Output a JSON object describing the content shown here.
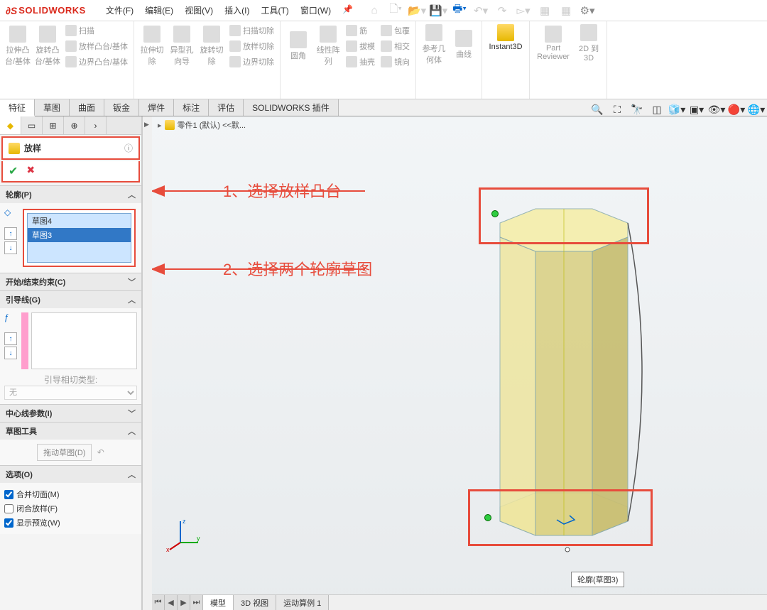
{
  "app": {
    "name": "SOLIDWORKS",
    "logo_prefix": "S"
  },
  "menu": {
    "file": "文件(F)",
    "edit": "编辑(E)",
    "view": "视图(V)",
    "insert": "插入(I)",
    "tools": "工具(T)",
    "window": "窗口(W)"
  },
  "ribbon": {
    "extrude": "拉伸凸台/基体",
    "revolve": "旋转凸台/基体",
    "sweep": "扫描",
    "loft": "放样凸台/基体",
    "boundary": "边界凸台/基体",
    "cut_extrude": "拉伸切除",
    "hole": "异型孔向导",
    "cut_revolve": "旋转切除",
    "cut_sweep": "扫描切除",
    "cut_loft": "放样切除",
    "cut_boundary": "边界切除",
    "fillet": "圆角",
    "pattern": "线性阵列",
    "rib": "筋",
    "draft": "拔模",
    "shell": "抽壳",
    "wrap": "包覆",
    "intersect": "相交",
    "mirror": "镜向",
    "refgeom": "参考几何体",
    "curves": "曲线",
    "instant3d": "Instant3D",
    "part_reviewer": "Part Reviewer",
    "to3d": "2D 到 3D"
  },
  "tabs": {
    "feature": "特征",
    "sketch": "草图",
    "surface": "曲面",
    "sheetmetal": "钣金",
    "weldment": "焊件",
    "annotate": "标注",
    "evaluate": "评估",
    "swplugin": "SOLIDWORKS 插件"
  },
  "breadcrumb": {
    "part": "零件1 (默认) <<默..."
  },
  "feature": {
    "title": "放样",
    "profiles_hdr": "轮廓(P)",
    "profile_items": [
      "草图4",
      "草图3"
    ],
    "constraints_hdr": "开始/结束约束(C)",
    "guides_hdr": "引导线(G)",
    "guide_tangent_label": "引导相切类型:",
    "guide_tangent_value": "无",
    "centerline_hdr": "中心线参数(I)",
    "sketchtools_hdr": "草图工具",
    "drag_sketch_btn": "拖动草图(D)",
    "options_hdr": "选项(O)",
    "opt_merge": "合并切面(M)",
    "opt_close": "闭合放样(F)",
    "opt_preview": "显示预览(W)"
  },
  "annotations": {
    "a1": "1、选择放样凸台",
    "a2": "2、选择两个轮廓草图"
  },
  "viewport": {
    "callout": "轮廓(草图3)"
  },
  "bottom_tabs": {
    "model": "模型",
    "view3d": "3D 视图",
    "motion": "运动算例 1"
  }
}
